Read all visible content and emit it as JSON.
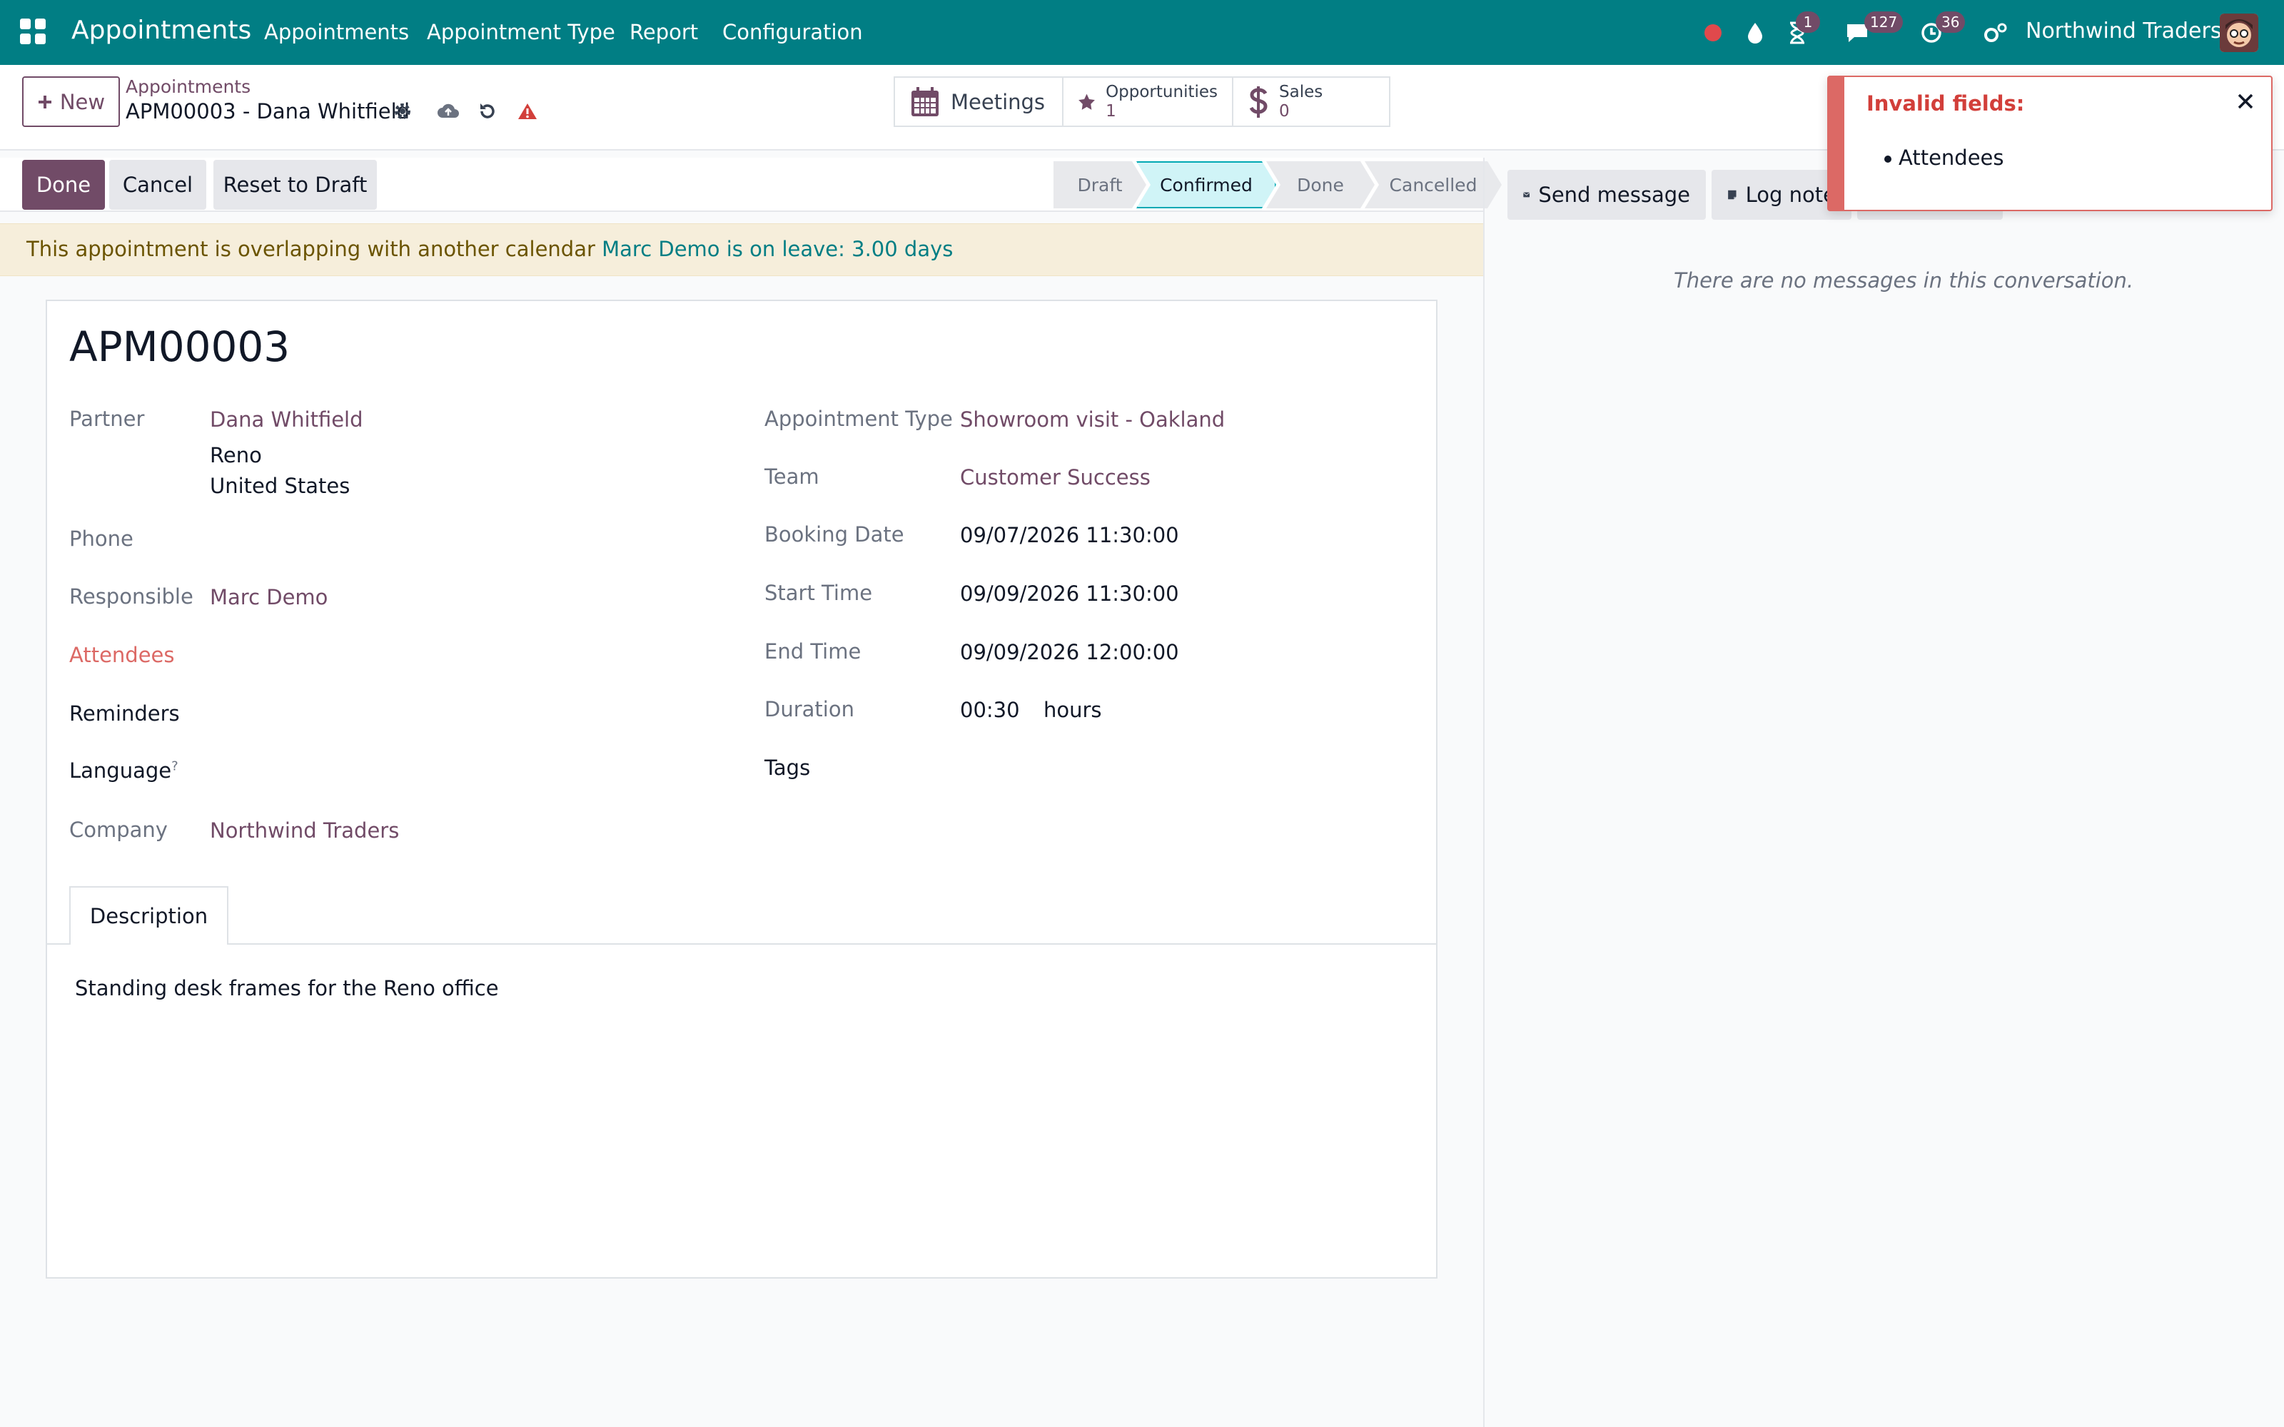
{
  "navbar": {
    "brand": "Appointments",
    "menu": [
      "Appointments",
      "Appointment Type",
      "Report",
      "Configuration"
    ],
    "badges": {
      "activities": "1",
      "messages": "127",
      "clock": "36"
    },
    "company": "Northwind Traders",
    "colors": {
      "bar": "#017e84",
      "badge": "#714b67"
    }
  },
  "control": {
    "new_label": "New",
    "breadcrumb_parent": "Appointments",
    "breadcrumb_current": "APM00003 - Dana Whitfield",
    "smart": {
      "meetings": "Meetings",
      "opportunities_label": "Opportunities",
      "opportunities_count": "1",
      "sales_label": "Sales",
      "sales_count": "0"
    }
  },
  "statusbar": {
    "buttons": [
      "Done",
      "Cancel",
      "Reset to Draft"
    ],
    "stages": [
      "Draft",
      "Confirmed",
      "Done",
      "Cancelled"
    ],
    "active_stage": "Confirmed"
  },
  "warning": {
    "text": "This appointment is overlapping with another calendar",
    "link": "Marc Demo is on leave: 3.00 days"
  },
  "form": {
    "title": "APM00003",
    "left": {
      "partner_label": "Partner",
      "partner_name": "Dana Whitfield",
      "partner_city": "Reno",
      "partner_country": "United States",
      "phone_label": "Phone",
      "responsible_label": "Responsible",
      "responsible_value": "Marc Demo",
      "attendees_label": "Attendees",
      "reminders_label": "Reminders",
      "language_label": "Language",
      "language_help": "?",
      "company_label": "Company",
      "company_value": "Northwind Traders"
    },
    "right": {
      "type_label": "Appointment Type",
      "type_value": "Showroom visit - Oakland",
      "team_label": "Team",
      "team_value": "Customer Success",
      "booking_label": "Booking Date",
      "booking_value": "09/07/2026 11:30:00",
      "start_label": "Start Time",
      "start_value": "09/09/2026 11:30:00",
      "end_label": "End Time",
      "end_value": "09/09/2026 12:00:00",
      "duration_label": "Duration",
      "duration_value": "00:30",
      "duration_unit": "hours",
      "tags_label": "Tags"
    },
    "tab_label": "Description",
    "description": "Standing desk frames for the Reno office"
  },
  "chatter": {
    "send_message": "Send message",
    "log_note": "Log note",
    "empty": "There are no messages in this conversation."
  },
  "toast": {
    "title": "Invalid fields:",
    "items": [
      "Attendees"
    ],
    "color": "#dc6965"
  }
}
